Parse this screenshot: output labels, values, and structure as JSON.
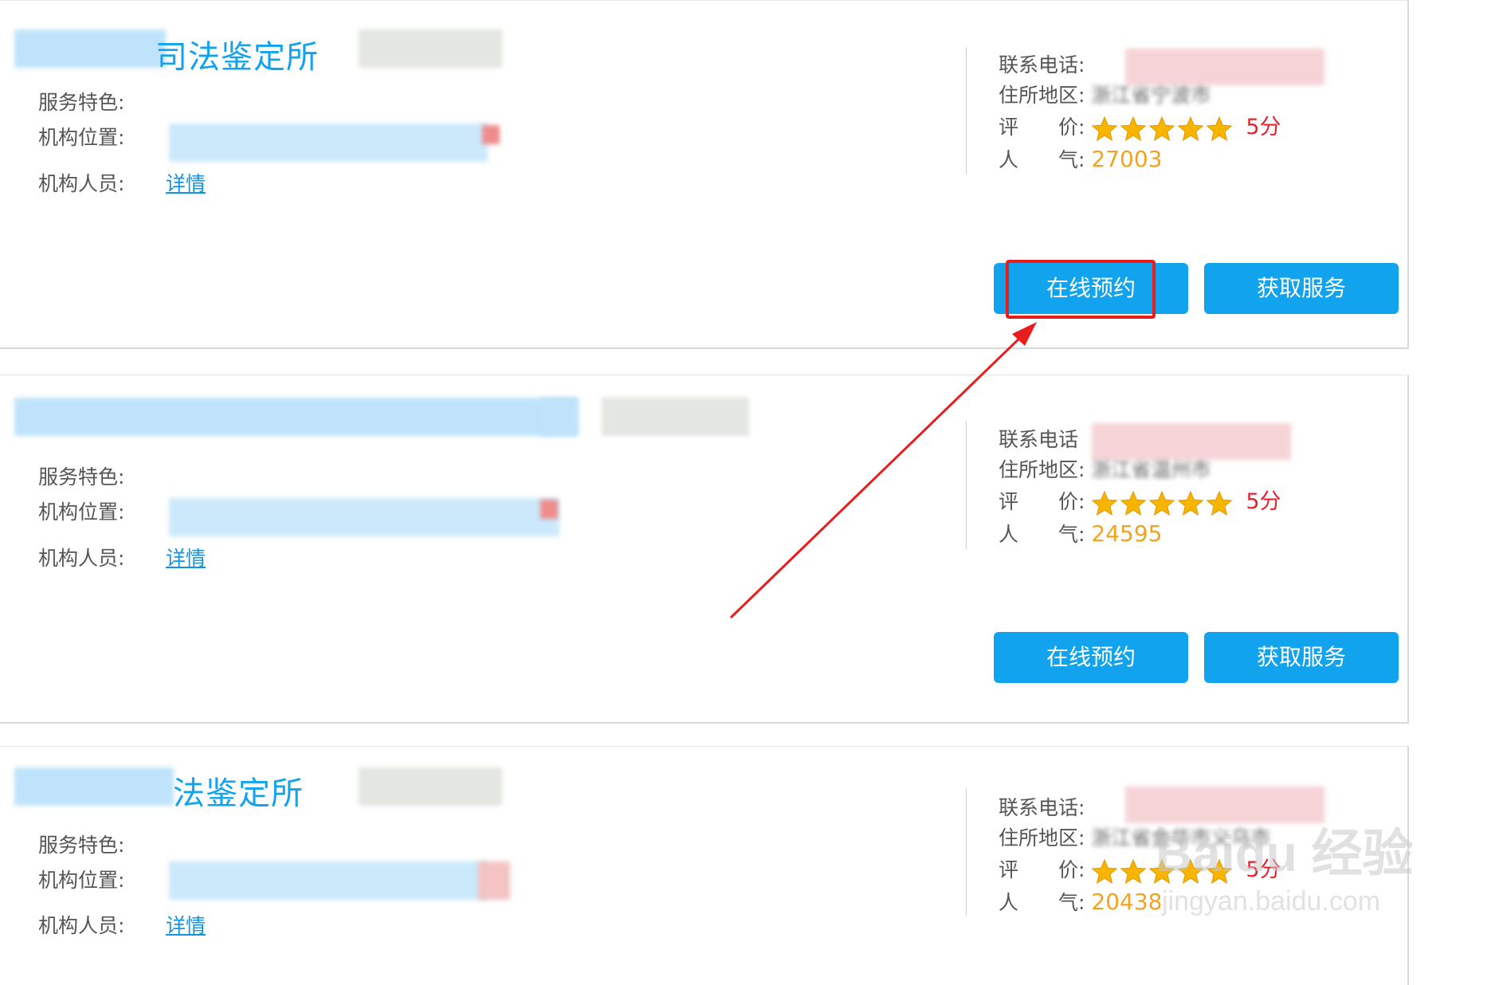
{
  "labels": {
    "service": "服务特色:",
    "location": "机构位置:",
    "staff": "机构人员:",
    "phone": "联系电话:",
    "phone_cut": "联系电话",
    "address": "住所地区:",
    "rating": "评　　价:",
    "popularity": "人　　气:"
  },
  "cards": [
    {
      "title_suffix": "司法鉴定所",
      "details_link": "详情",
      "address_fragment": "浙江省宁波市",
      "rating_stars": 5,
      "rating_text": "5分",
      "popularity": "27003",
      "button_booking": "在线预约",
      "button_service": "获取服务"
    },
    {
      "title_suffix": "",
      "details_link": "详情",
      "address_fragment": "浙江省温州市",
      "rating_stars": 5,
      "rating_text": "5分",
      "popularity": "24595",
      "button_booking": "在线预约",
      "button_service": "获取服务"
    },
    {
      "title_suffix": "法鉴定所",
      "details_link": "详情",
      "address_fragment": "浙江省金华市义乌市",
      "rating_stars": 5,
      "rating_text": "5分",
      "popularity": "20438"
    }
  ],
  "watermark": {
    "brand": "Baidu 经验",
    "url": "jingyan.baidu.com"
  },
  "colors": {
    "accent_blue": "#11a3ed",
    "score_red": "#e3232e",
    "popularity_orange": "#f3a31d",
    "star_yellow": "#f7b500",
    "annotation_red": "#e81d1d"
  }
}
